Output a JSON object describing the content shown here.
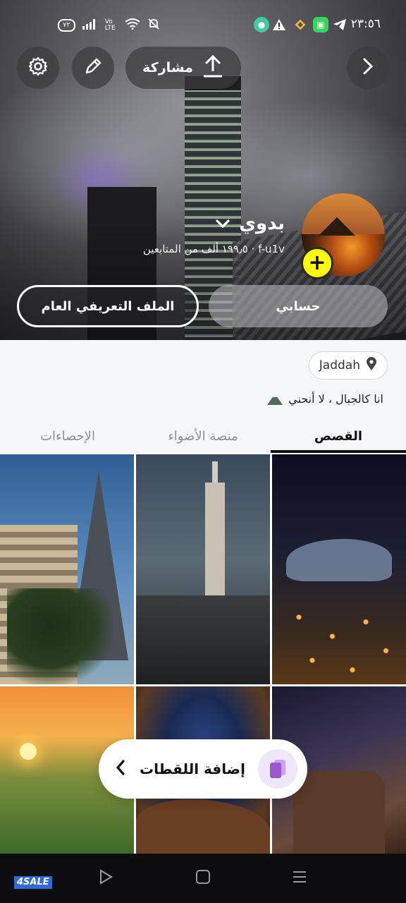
{
  "status_bar": {
    "time": "٢٣:٥٦",
    "battery": "٧٢",
    "network_label": "Vo LTE"
  },
  "top_bar": {
    "share_label": "مشاركة"
  },
  "profile": {
    "display_name": "بدوي",
    "username_followers": "f-u1v · ١٩٩٫٥ ألف من المتابعين",
    "public_profile_button": "الملف التعريفي العام",
    "account_button": "حسابي",
    "location": "Jaddah",
    "bio": "انا كالجبال ، لا أنحني"
  },
  "tabs": [
    {
      "label": "القصص",
      "active": true
    },
    {
      "label": "منصة الأضواء",
      "active": false
    },
    {
      "label": "الإحصاءات",
      "active": false
    }
  ],
  "add_snaps": {
    "label": "إضافة اللقطات"
  },
  "nav_bar": {
    "brand": "4SALE"
  },
  "colors": {
    "accent_yellow": "#fffc00",
    "snaps_icon_purple": "#9b59d0",
    "active_tab": "#111111",
    "inactive_tab": "#8c8f94"
  }
}
